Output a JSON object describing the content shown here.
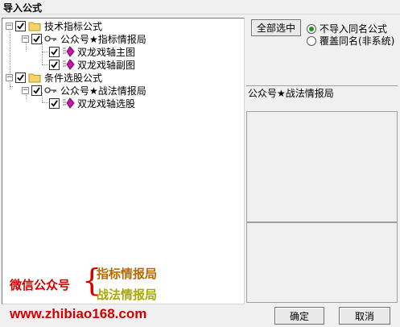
{
  "window": {
    "title": "导入公式"
  },
  "tree": {
    "group1_label": "技术指标公式",
    "group1_child_label": "公众号★指标情报局",
    "group1_leaf1_label": "双龙戏轴主图",
    "group1_leaf2_label": "双龙戏轴副图",
    "group2_label": "条件选股公式",
    "group2_child_label": "公众号★战法情报局",
    "group2_leaf1_label": "双龙戏轴选股",
    "expander_symbol": "−"
  },
  "watermark": {
    "line_left": "微信公众号",
    "brace": "{",
    "line_top": "指标情报局",
    "line_bottom": "战法情报局",
    "url": "www.zhibiao168.com"
  },
  "options": {
    "select_all_label": "全部选中",
    "radio1_label": "不导入同名公式",
    "radio2_label": "覆盖同名(非系统)",
    "selected": "radio1"
  },
  "detail": {
    "name": "公众号★战法情报局"
  },
  "footer": {
    "ok_label": "确定",
    "cancel_label": "取消"
  },
  "colors": {
    "watermark_red": "#d40000",
    "watermark_orange": "#b86a00",
    "watermark_olive": "#a8a800",
    "radio_green": "#1a9a1a"
  }
}
